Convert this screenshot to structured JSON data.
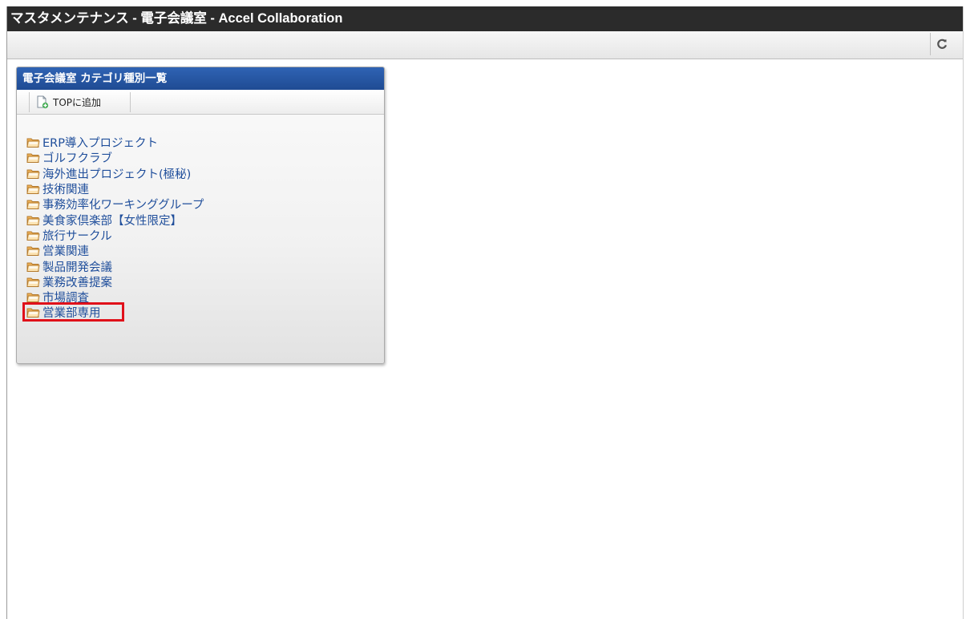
{
  "window": {
    "title": "マスタメンテナンス - 電子会議室 - Accel Collaboration"
  },
  "toolbar": {
    "refresh_icon": "refresh-icon"
  },
  "portlet": {
    "title": "電子会議室 カテゴリ種別一覧",
    "add_to_top_label": "TOPに追加",
    "categories": [
      "ERP導入プロジェクト",
      "ゴルフクラブ",
      "海外進出プロジェクト(極秘)",
      "技術関連",
      "事務効率化ワーキンググループ",
      "美食家倶楽部【女性限定】",
      "旅行サークル",
      "営業関連",
      "製品開発会議",
      "業務改善提案",
      "市場調査",
      "営業部専用"
    ],
    "selected_category": "営業部専用"
  },
  "colors": {
    "titlebar_bg": "#2b2b2b",
    "portlet_header": "#2a5aa8",
    "link": "#1f4e9b",
    "highlight": "#e0101a"
  }
}
